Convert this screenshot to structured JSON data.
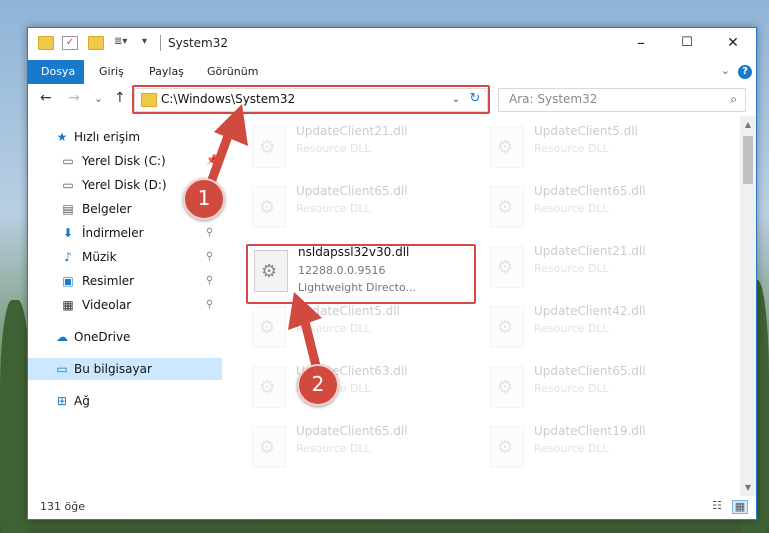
{
  "window": {
    "title": "System32",
    "minimize": "–",
    "maximize": "☐",
    "close": "✕"
  },
  "ribbon": {
    "tabs": [
      "Dosya",
      "Giriş",
      "Paylaş",
      "Görünüm"
    ],
    "expand": "⌄",
    "help": "?"
  },
  "nav": {
    "back": "←",
    "forward": "→",
    "recent": "⌄",
    "up": "↑",
    "address": "C:\\Windows\\System32",
    "address_dropdown": "⌄",
    "refresh": "↻",
    "search_placeholder": "Ara: System32",
    "search_icon": "⌕"
  },
  "sidebar": {
    "items": [
      {
        "label": "Hızlı erişim",
        "icon": "star-icon"
      },
      {
        "label": "Yerel Disk (C:)",
        "icon": "drive-icon"
      },
      {
        "label": "Yerel Disk (D:)",
        "icon": "drive-icon"
      },
      {
        "label": "Belgeler",
        "icon": "documents-icon"
      },
      {
        "label": "İndirmeler",
        "icon": "download-icon"
      },
      {
        "label": "Müzik",
        "icon": "music-icon"
      },
      {
        "label": "Resimler",
        "icon": "pictures-icon"
      },
      {
        "label": "Videolar",
        "icon": "video-icon"
      },
      {
        "label": "OneDrive",
        "icon": "cloud-icon"
      },
      {
        "label": "Bu bilgisayar",
        "icon": "computer-icon"
      },
      {
        "label": "Ağ",
        "icon": "network-icon"
      }
    ]
  },
  "files": {
    "left": [
      {
        "name": "UpdateClient21.dll",
        "type": "Resource DLL"
      },
      {
        "name": "UpdateClient65.dll",
        "type": "Resource DLL"
      },
      {
        "name": "nsldapssl32v30.dll",
        "version": "12288.0.0.9516",
        "type": "Lightweight Directo..."
      },
      {
        "name": "UpdateClient5.dll",
        "type": "Resource DLL"
      },
      {
        "name": "UpdateClient63.dll",
        "type": "Resource DLL"
      },
      {
        "name": "UpdateClient65.dll",
        "type": "Resource DLL"
      }
    ],
    "right": [
      {
        "name": "UpdateClient5.dll",
        "type": "Resource DLL"
      },
      {
        "name": "UpdateClient65.dll",
        "type": "Resource DLL"
      },
      {
        "name": "UpdateClient21.dll",
        "type": "Resource DLL"
      },
      {
        "name": "UpdateClient42.dll",
        "type": "Resource DLL"
      },
      {
        "name": "UpdateClient65.dll",
        "type": "Resource DLL"
      },
      {
        "name": "UpdateClient19.dll",
        "type": "Resource DLL"
      }
    ]
  },
  "status": {
    "count": "131 öğe"
  },
  "annotations": {
    "step1": "1",
    "step2": "2"
  },
  "colors": {
    "accent": "#1979ca",
    "highlight": "#d94848",
    "badge": "#d04a3f"
  }
}
